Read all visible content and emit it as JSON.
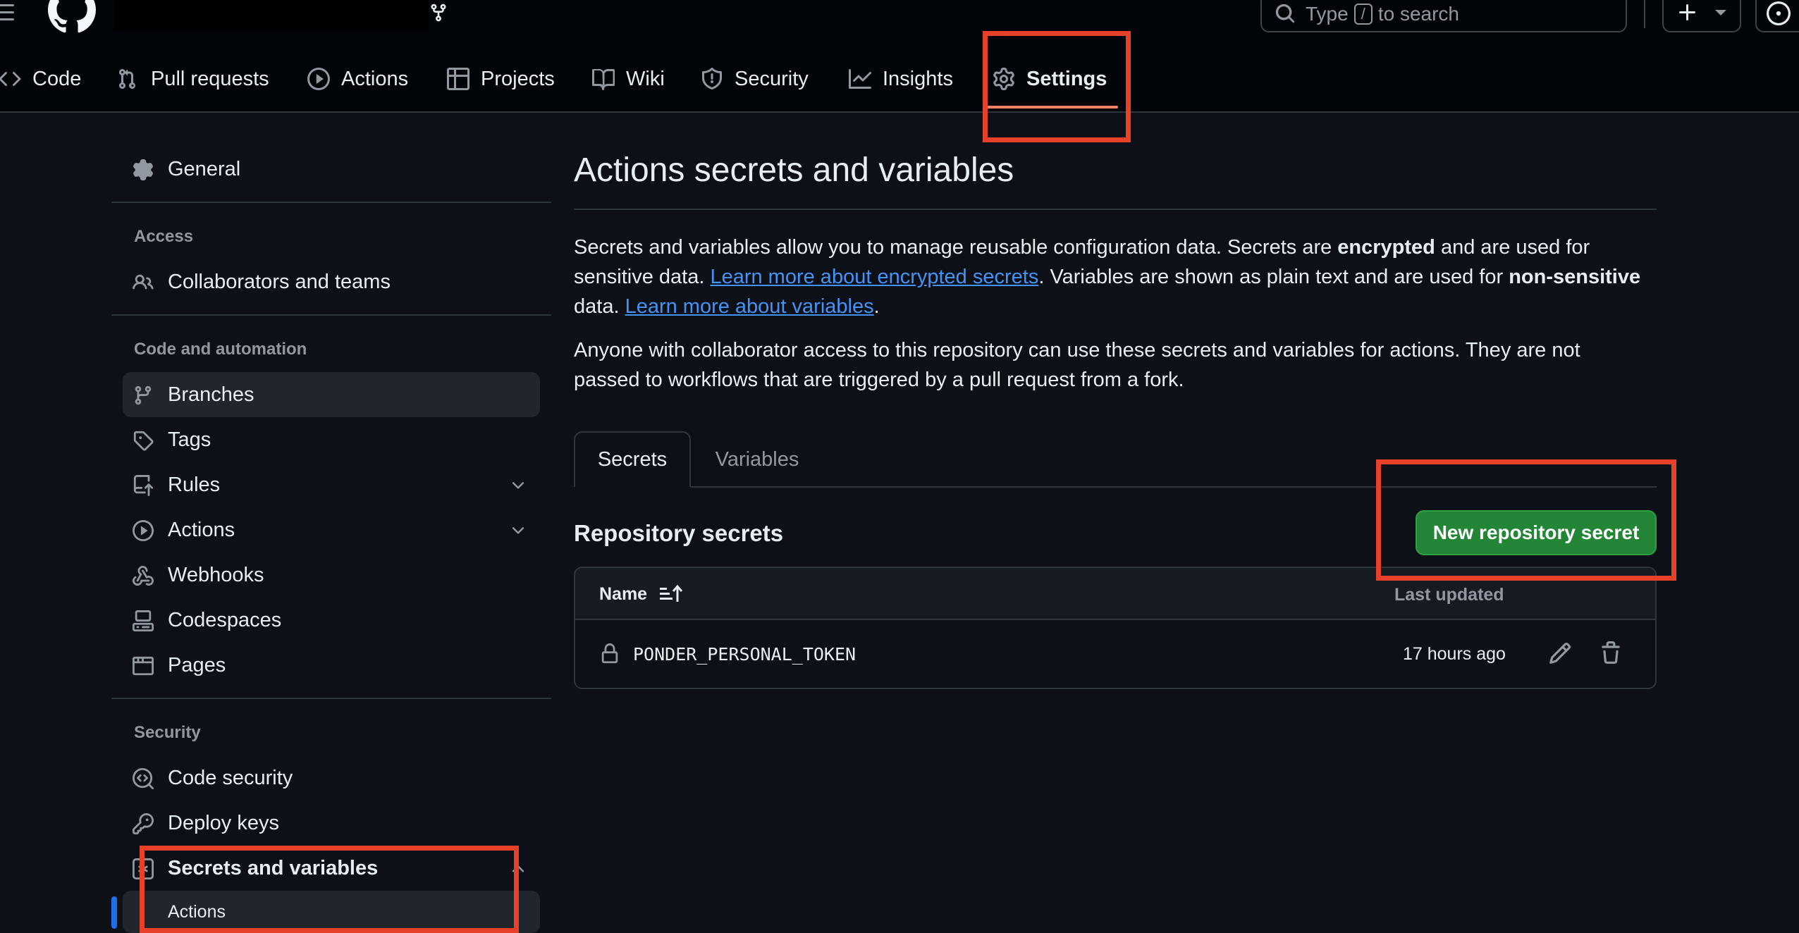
{
  "header": {
    "search_prefix": "Type",
    "search_key": "/",
    "search_suffix": "to search"
  },
  "repo_tabs": [
    {
      "label": "Code",
      "icon": "code-icon"
    },
    {
      "label": "Pull requests",
      "icon": "pull-request-icon"
    },
    {
      "label": "Actions",
      "icon": "play-icon"
    },
    {
      "label": "Projects",
      "icon": "table-icon"
    },
    {
      "label": "Wiki",
      "icon": "book-icon"
    },
    {
      "label": "Security",
      "icon": "shield-icon"
    },
    {
      "label": "Insights",
      "icon": "graph-icon"
    },
    {
      "label": "Settings",
      "icon": "gear-icon",
      "active": true
    }
  ],
  "sidebar": {
    "general": "General",
    "access_heading": "Access",
    "collaborators": "Collaborators and teams",
    "code_automation_heading": "Code and automation",
    "branches": "Branches",
    "tags": "Tags",
    "rules": "Rules",
    "actions": "Actions",
    "webhooks": "Webhooks",
    "codespaces": "Codespaces",
    "pages": "Pages",
    "security_heading": "Security",
    "code_security": "Code security",
    "deploy_keys": "Deploy keys",
    "secrets_variables": "Secrets and variables",
    "secrets_actions": "Actions"
  },
  "main": {
    "title": "Actions secrets and variables",
    "intro_1": "Secrets and variables allow you to manage reusable configuration data. Secrets are ",
    "intro_bold_1": "encrypted",
    "intro_2": " and are used for sensitive data. ",
    "link_secrets": "Learn more about encrypted secrets",
    "intro_3": ". Variables are shown as plain text and are used for ",
    "intro_bold_2": "non-sensitive",
    "intro_4": " data. ",
    "link_variables": "Learn more about variables",
    "intro_5": ".",
    "access_note": "Anyone with collaborator access to this repository can use these secrets and variables for actions. They are not passed to workflows that are triggered by a pull request from a fork.",
    "tab_secrets": "Secrets",
    "tab_variables": "Variables",
    "repo_secrets_title": "Repository secrets",
    "new_secret_button": "New repository secret",
    "table": {
      "col_name": "Name",
      "col_updated": "Last updated",
      "rows": [
        {
          "name": "PONDER_PERSONAL_TOKEN",
          "updated": "17 hours ago"
        }
      ]
    }
  },
  "colors": {
    "background": "#0d1117",
    "accent_green": "#238636",
    "link_blue": "#4493f8",
    "tab_underline": "#f78166",
    "annotation_red": "#e8412a"
  }
}
